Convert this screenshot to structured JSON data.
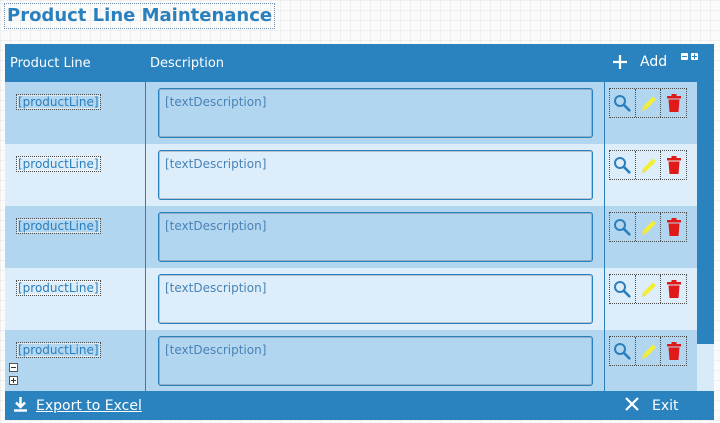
{
  "page": {
    "title": "Product Line Maintenance"
  },
  "table": {
    "columns": {
      "product_line": "Product Line",
      "description": "Description"
    },
    "add_label": "Add",
    "rows": [
      {
        "product_line": "[productLine]",
        "description": "[textDescription]"
      },
      {
        "product_line": "[productLine]",
        "description": "[textDescription]"
      },
      {
        "product_line": "[productLine]",
        "description": "[textDescription]"
      },
      {
        "product_line": "[productLine]",
        "description": "[textDescription]"
      },
      {
        "product_line": "[productLine]",
        "description": "[textDescription]"
      }
    ]
  },
  "footer": {
    "export_label": "Export to Excel",
    "exit_label": "Exit"
  },
  "colors": {
    "brand": "#2a83bf",
    "row_dark": "#b2d6ef",
    "row_light": "#ddeefa",
    "edit_icon": "#f3ee35",
    "delete_icon": "#e01919"
  },
  "icons": [
    "plus-icon",
    "search-icon",
    "pencil-icon",
    "trash-icon",
    "download-icon",
    "close-icon",
    "collapse-icon",
    "expand-icon"
  ]
}
